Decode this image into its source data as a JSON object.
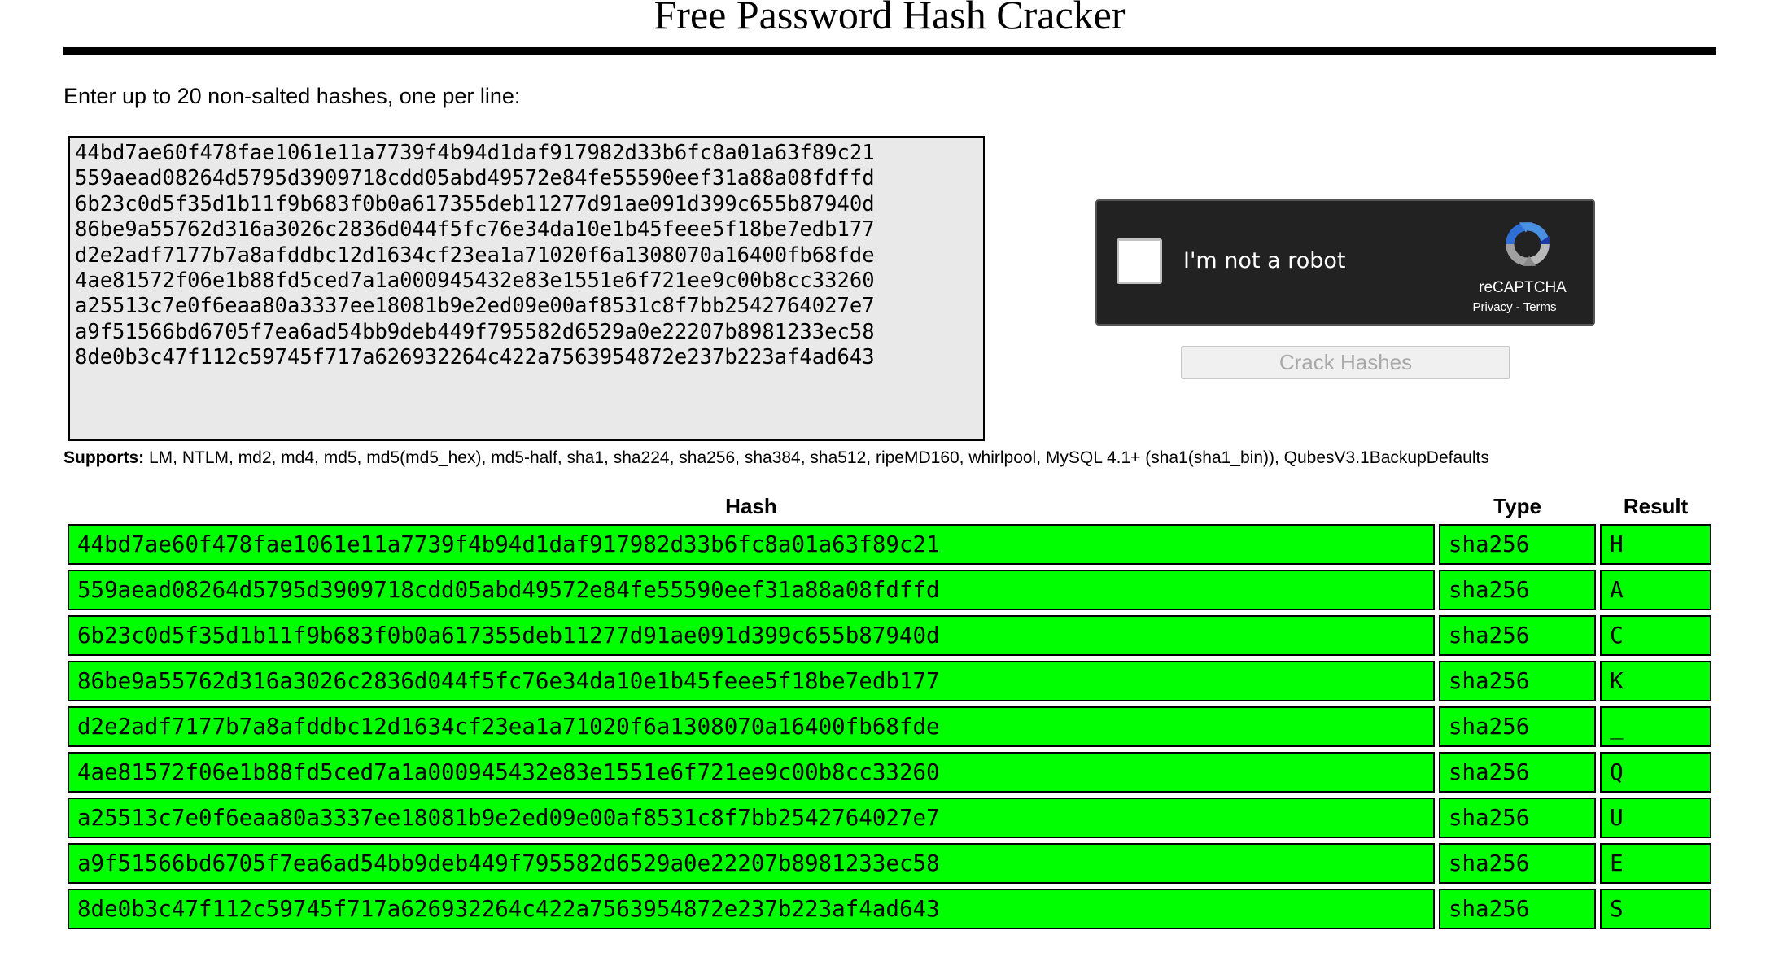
{
  "page": {
    "title": "Free Password Hash Cracker",
    "instructions": "Enter up to 20 non-salted hashes, one per line:",
    "hashes_input": "44bd7ae60f478fae1061e11a7739f4b94d1daf917982d33b6fc8a01a63f89c21\n559aead08264d5795d3909718cdd05abd49572e84fe55590eef31a88a08fdffd\n6b23c0d5f35d1b11f9b683f0b0a617355deb11277d91ae091d399c655b87940d\n86be9a55762d316a3026c2836d044f5fc76e34da10e1b45feee5f18be7edb177\nd2e2adf7177b7a8afddbc12d1634cf23ea1a71020f6a1308070a16400fb68fde\n4ae81572f06e1b88fd5ced7a1a000945432e83e1551e6f721ee9c00b8cc33260\na25513c7e0f6eaa80a3337ee18081b9e2ed09e00af8531c8f7bb2542764027e7\na9f51566bd6705f7ea6ad54bb9deb449f795582d6529a0e22207b8981233ec58\n8de0b3c47f112c59745f717a626932264c422a7563954872e237b223af4ad643",
    "supports_label": "Supports:",
    "supports_list": " LM, NTLM, md2, md4, md5, md5(md5_hex), md5-half, sha1, sha224, sha256, sha384, sha512, ripeMD160, whirlpool, MySQL 4.1+ (sha1(sha1_bin)), QubesV3.1BackupDefaults"
  },
  "captcha": {
    "label": "I'm not a robot",
    "brand": "reCAPTCHA",
    "privacy": "Privacy",
    "separator": " - ",
    "terms": "Terms",
    "checked": false
  },
  "crack_button_label": "Crack Hashes",
  "results": {
    "headers": [
      "Hash",
      "Type",
      "Result"
    ],
    "success_color": "#00ff00",
    "rows": [
      {
        "hash": "44bd7ae60f478fae1061e11a7739f4b94d1daf917982d33b6fc8a01a63f89c21",
        "type": "sha256",
        "result": "H"
      },
      {
        "hash": "559aead08264d5795d3909718cdd05abd49572e84fe55590eef31a88a08fdffd",
        "type": "sha256",
        "result": "A"
      },
      {
        "hash": "6b23c0d5f35d1b11f9b683f0b0a617355deb11277d91ae091d399c655b87940d",
        "type": "sha256",
        "result": "C"
      },
      {
        "hash": "86be9a55762d316a3026c2836d044f5fc76e34da10e1b45feee5f18be7edb177",
        "type": "sha256",
        "result": "K"
      },
      {
        "hash": "d2e2adf7177b7a8afddbc12d1634cf23ea1a71020f6a1308070a16400fb68fde",
        "type": "sha256",
        "result": "_"
      },
      {
        "hash": "4ae81572f06e1b88fd5ced7a1a000945432e83e1551e6f721ee9c00b8cc33260",
        "type": "sha256",
        "result": "Q"
      },
      {
        "hash": "a25513c7e0f6eaa80a3337ee18081b9e2ed09e00af8531c8f7bb2542764027e7",
        "type": "sha256",
        "result": "U"
      },
      {
        "hash": "a9f51566bd6705f7ea6ad54bb9deb449f795582d6529a0e22207b8981233ec58",
        "type": "sha256",
        "result": "E"
      },
      {
        "hash": "8de0b3c47f112c59745f717a626932264c422a7563954872e237b223af4ad643",
        "type": "sha256",
        "result": "S"
      }
    ]
  }
}
